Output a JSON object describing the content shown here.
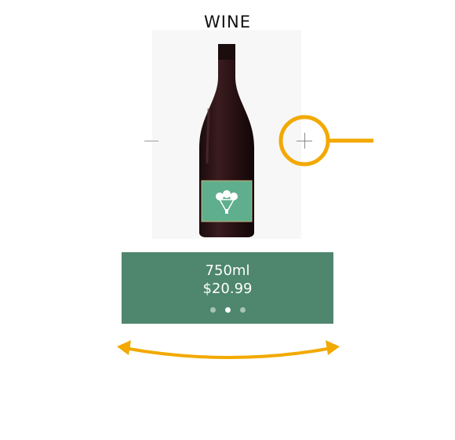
{
  "product": {
    "category_title": "WINE",
    "volume": "750ml",
    "price": "$20.99",
    "image": "wine-bottle"
  },
  "carousel": {
    "count": 3,
    "active_index": 1
  },
  "colors": {
    "panel": "#4e866e",
    "accent": "#f2a900",
    "bottle": "#2b1416",
    "label": "#5fae8e"
  },
  "icons": {
    "decrease": "minus-icon",
    "increase": "plus-icon",
    "callout": "highlight-circle-icon",
    "swipe": "double-arrow-icon"
  }
}
